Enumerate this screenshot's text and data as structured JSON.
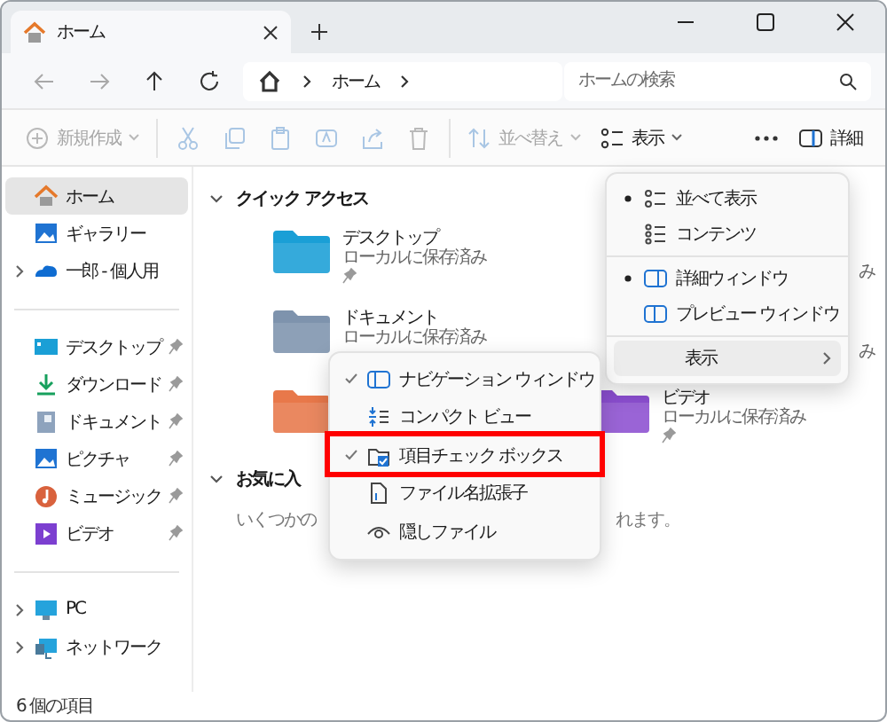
{
  "tab": {
    "title": "ホーム",
    "selected": true
  },
  "address": {
    "crumbs": [
      "ホーム"
    ]
  },
  "search": {
    "placeholder": "ホームの検索"
  },
  "toolbar": [
    {
      "kind": "labeled",
      "label": "新規作成",
      "disabled": true,
      "dropdown": true
    },
    {
      "kind": "icon",
      "disabled": true
    },
    {
      "kind": "icon",
      "disabled": true
    },
    {
      "kind": "icon",
      "disabled": true
    },
    {
      "kind": "icon",
      "disabled": true
    },
    {
      "kind": "icon",
      "disabled": true
    },
    {
      "kind": "icon",
      "disabled": true
    },
    {
      "kind": "labeled",
      "label": "並べ替え",
      "disabled": true,
      "dropdown": true
    },
    {
      "kind": "labeled",
      "label": "表示",
      "disabled": false,
      "dropdown": true
    },
    {
      "kind": "icon",
      "disabled": false
    },
    {
      "kind": "labeled",
      "label": "詳細",
      "disabled": false,
      "dropdown": false
    }
  ],
  "sidebar": {
    "groups": [
      {
        "items": [
          {
            "label": "ホーム",
            "selected": true
          },
          {
            "label": "ギャラリー",
            "selected": false
          },
          {
            "label": "一郎 - 個人用",
            "selected": false,
            "expanded": false
          }
        ]
      },
      {
        "items": [
          {
            "label": "デスクトップ",
            "selected": false,
            "pinned": true
          },
          {
            "label": "ダウンロード",
            "selected": false,
            "pinned": true
          },
          {
            "label": "ドキュメント",
            "selected": false,
            "pinned": true
          },
          {
            "label": "ピクチャ",
            "selected": false,
            "pinned": true
          },
          {
            "label": "ミュージック",
            "selected": false,
            "pinned": true
          },
          {
            "label": "ビデオ",
            "selected": false,
            "pinned": true
          }
        ]
      },
      {
        "items": [
          {
            "label": "PC",
            "selected": false,
            "expanded": false
          },
          {
            "label": "ネットワーク",
            "selected": false,
            "expanded": false
          }
        ]
      }
    ]
  },
  "sections": [
    {
      "title": "クイック アクセス",
      "expanded": true,
      "tiles": [
        {
          "kind": "full",
          "name": "デスクトップ",
          "status": "ローカルに保存済み",
          "pinned": true,
          "color": "#1a9fd6"
        },
        {
          "kind": "partial",
          "status": "み"
        },
        {
          "kind": "full",
          "name": "ドキュメント",
          "status": "ローカルに保存済み",
          "pinned": false,
          "color": "#7e93ad"
        },
        {
          "kind": "partial",
          "status": "み"
        },
        {
          "kind": "icon",
          "color": "#e8784a"
        },
        {
          "kind": "full",
          "name": "ビデオ",
          "status": "ローカルに保存済み",
          "pinned": true,
          "color": "#8c4fd1"
        }
      ]
    },
    {
      "title": "お気に入",
      "expanded": true,
      "hint": [
        "いくつかの",
        "れます。"
      ]
    }
  ],
  "layout_menu": {
    "items": [
      {
        "kind": "option",
        "label": "並べて表示",
        "selected": true
      },
      {
        "kind": "option",
        "label": "コンテンツ",
        "selected": false
      },
      {
        "kind": "divider"
      },
      {
        "kind": "option",
        "label": "詳細ウィンドウ",
        "selected": true
      },
      {
        "kind": "option",
        "label": "プレビュー ウィンドウ",
        "selected": false
      },
      {
        "kind": "divider"
      },
      {
        "kind": "submenu",
        "label": "表示",
        "hovered": true
      }
    ]
  },
  "show_menu": {
    "items": [
      {
        "label": "ナビゲーション ウィンドウ",
        "checked": true,
        "highlighted": false
      },
      {
        "label": "コンパクト ビュー",
        "checked": false,
        "highlighted": false
      },
      {
        "label": "項目チェック ボックス",
        "checked": true,
        "highlighted": true
      },
      {
        "label": "ファイル名拡張子",
        "checked": false,
        "highlighted": false
      },
      {
        "label": "隠しファイル",
        "checked": false,
        "highlighted": false
      }
    ]
  },
  "status_bar": {
    "text": "6 個の項目"
  }
}
